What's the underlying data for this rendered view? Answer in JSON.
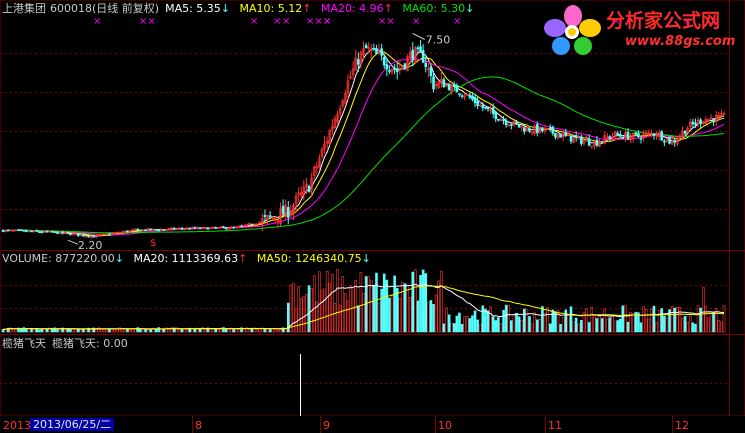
{
  "colors": {
    "up": "#ff3232",
    "down": "#54ffff",
    "text": "#c8c8c8",
    "grid": "#7a0000",
    "ma5": "#ffffff",
    "ma10": "#ffff00",
    "ma20": "#ff00ff",
    "ma60": "#00e000",
    "vol_ma20": "#ffffff",
    "vol_ma50": "#ffff00",
    "header_accent": "#54ffff"
  },
  "price_header": {
    "name": "上港集团",
    "code_mode": "600018(日线 前复权)",
    "ma5": "MA5: 5.35",
    "ma10": "MA10: 5.12",
    "ma20": "MA20: 4.96",
    "ma60": "MA60: 5.30"
  },
  "volume_header": {
    "volume": "VOLUME: 877220.00",
    "ma20": "MA20: 1113369.63",
    "ma50": "MA50: 1246340.75"
  },
  "indicator_header": {
    "name": "榄猪飞天",
    "value_label": "榄猪飞天: 0.00"
  },
  "annotations": {
    "high_label": "7.50",
    "low_label": "2.20",
    "dollar_mark": "$"
  },
  "date_axis": {
    "start_year": "2013",
    "cursor_date": "2013/06/25/二",
    "month_labels": [
      "8",
      "9",
      "10",
      "11",
      "12"
    ]
  },
  "logo": {
    "text_cn": "分析家公式网",
    "url": "www.88gs.com"
  },
  "chart_data": {
    "type": "candlestick",
    "price": {
      "ylim": [
        2.0,
        8.0
      ],
      "max": 7.5,
      "min": 2.2,
      "ma_latest": {
        "MA5": 5.35,
        "MA10": 5.12,
        "MA20": 4.96,
        "MA60": 5.3
      }
    },
    "volume": {
      "latest": 877220.0,
      "ma_latest": {
        "MA20": 1113369.63,
        "MA50": 1246340.75
      }
    },
    "indicator": {
      "latest": 0.0
    },
    "x_labels": [
      "2013",
      "8",
      "9",
      "10",
      "11",
      "12"
    ]
  }
}
